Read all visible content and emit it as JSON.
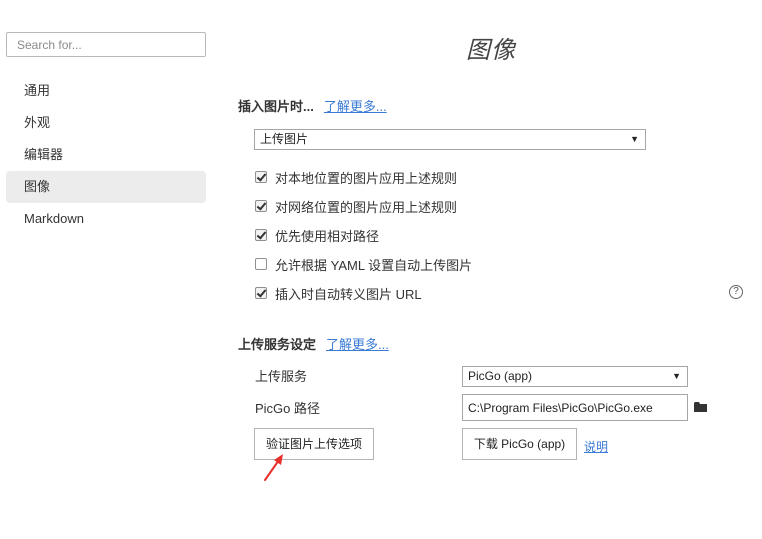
{
  "sidebar": {
    "search_placeholder": "Search for...",
    "items": [
      {
        "label": "通用"
      },
      {
        "label": "外观"
      },
      {
        "label": "编辑器"
      },
      {
        "label": "图像",
        "active": true
      },
      {
        "label": "Markdown"
      }
    ]
  },
  "main": {
    "title": "图像",
    "insert_section": {
      "title": "插入图片时...",
      "learn_more": "了解更多...",
      "action_select": "上传图片",
      "options": [
        {
          "label": "对本地位置的图片应用上述规则",
          "checked": true
        },
        {
          "label": "对网络位置的图片应用上述规则",
          "checked": true
        },
        {
          "label": "优先使用相对路径",
          "checked": true
        },
        {
          "label": "允许根据 YAML 设置自动上传图片",
          "checked": false
        },
        {
          "label": "插入时自动转义图片 URL",
          "checked": true
        }
      ],
      "help_icon": "?"
    },
    "upload_section": {
      "title": "上传服务设定",
      "learn_more": "了解更多...",
      "service_label": "上传服务",
      "service_value": "PicGo (app)",
      "path_label": "PicGo 路径",
      "path_value": "C:\\Program Files\\PicGo\\PicGo.exe",
      "verify_button": "验证图片上传选项",
      "download_button": "下载 PicGo (app)",
      "explain_link": "说明"
    }
  },
  "colors": {
    "accent_link": "#3a7bd5",
    "annotation_arrow": "#e8302a",
    "active_nav_bg": "#ececec"
  }
}
